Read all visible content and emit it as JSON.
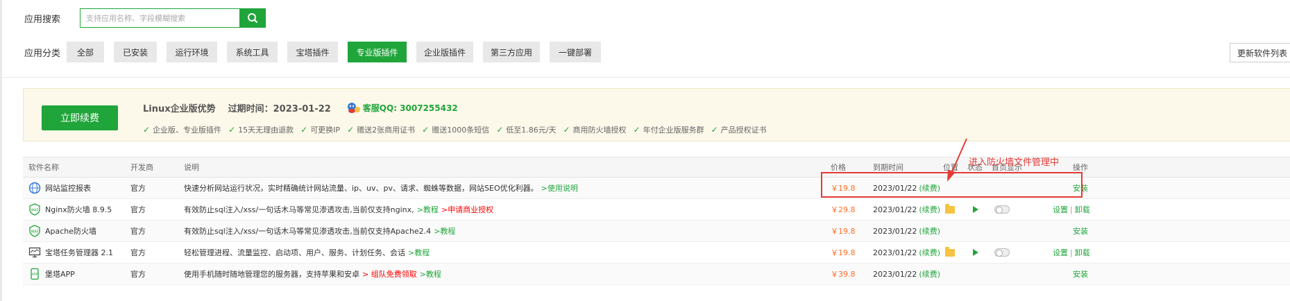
{
  "search": {
    "label": "应用搜索",
    "placeholder": "支持应用名称、字段模糊搜索"
  },
  "categories": {
    "label": "应用分类",
    "items": [
      {
        "label": "全部",
        "active": false
      },
      {
        "label": "已安装",
        "active": false
      },
      {
        "label": "运行环境",
        "active": false
      },
      {
        "label": "系统工具",
        "active": false
      },
      {
        "label": "宝塔插件",
        "active": false
      },
      {
        "label": "专业版插件",
        "active": true
      },
      {
        "label": "企业版插件",
        "active": false
      },
      {
        "label": "第三方应用",
        "active": false
      },
      {
        "label": "一键部署",
        "active": false
      }
    ],
    "update_button": "更新软件列表"
  },
  "banner": {
    "renew_button": "立即续费",
    "title": "Linux企业版优势",
    "expire": "过期时间：2023-01-22",
    "qq": "客服QQ: 3007255432",
    "features": [
      "企业版、专业版插件",
      "15天无理由退款",
      "可更换IP",
      "赠送2张商用证书",
      "赠送1000条短信",
      "低至1.86元/天",
      "商用防火墙授权",
      "年付企业版服务群",
      "产品授权证书"
    ]
  },
  "table": {
    "headers": {
      "name": "软件名称",
      "dev": "开发商",
      "desc": "说明",
      "price": "价格",
      "expire": "到期时间",
      "position": "位置",
      "status": "状态",
      "home": "首页显示",
      "op": "操作"
    },
    "rows": [
      {
        "name": "网站监控报表",
        "dev": "官方",
        "desc": "快速分析网站运行状况，实时精确统计网站流量、ip、uv、pv、请求、蜘蛛等数据，网站SEO优化利器。",
        "link1": ">使用说明",
        "link2": "",
        "price": "￥19.8",
        "expire": "2023/01/22",
        "renew": "(续费)",
        "op1": "安装",
        "op2": ""
      },
      {
        "name": "Nginx防火墙 8.9.5",
        "dev": "官方",
        "desc": "有效防止sql注入/xss/一句话木马等常见渗透攻击,当前仅支持nginx,",
        "link1": ">教程",
        "link2": ">申请商业授权",
        "price": "￥29.8",
        "expire": "2023/01/22",
        "renew": "(续费)",
        "op1": "设置",
        "op2": "卸载"
      },
      {
        "name": "Apache防火墙",
        "dev": "官方",
        "desc": "有效防止sql注入/xss/一句话木马等常见渗透攻击,当前仅支持Apache2.4",
        "link1": ">教程",
        "link2": "",
        "price": "￥19.8",
        "expire": "2023/01/22",
        "renew": "(续费)",
        "op1": "安装",
        "op2": ""
      },
      {
        "name": "宝塔任务管理器 2.1",
        "dev": "官方",
        "desc": "轻松管理进程、流量监控、启动项、用户、服务、计划任务、会话",
        "link1": ">教程",
        "link2": "",
        "price": "￥19.8",
        "expire": "2023/01/22",
        "renew": "(续费)",
        "op1": "设置",
        "op2": "卸载"
      },
      {
        "name": "堡塔APP",
        "dev": "官方",
        "desc": "使用手机随时随地管理您的服务器，支持苹果和安卓",
        "link1": ">教程",
        "link2": "> 组队免费领取",
        "price": "￥39.8",
        "expire": "2023/01/22",
        "renew": "(续费)",
        "op1": "安装",
        "op2": ""
      }
    ]
  },
  "annotation": {
    "text": "进入防火墙文件管理中",
    "color": "#e53935"
  },
  "colors": {
    "accent": "#20a53a",
    "price": "#fc6d26",
    "banner_bg": "#fcf8ea"
  }
}
